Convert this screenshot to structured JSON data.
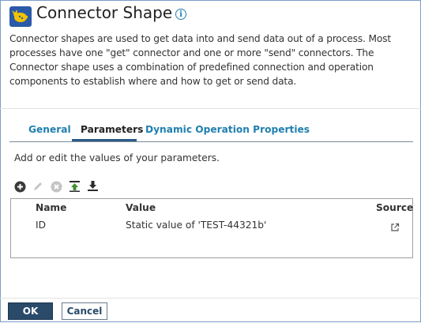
{
  "header": {
    "title": "Connector Shape",
    "icon": "connector-icon",
    "info_icon": "info-icon",
    "info_glyph": "i"
  },
  "description": "Connector shapes are used to get data into and send data out of a process. Most processes have one \"get\" connector and one or more \"send\" connectors. The Connector shape uses a combination of predefined connection and operation components to establish where and how to get or send data.",
  "tabs": [
    {
      "label": "General",
      "active": false
    },
    {
      "label": "Parameters",
      "active": true
    },
    {
      "label": "Dynamic Operation Properties",
      "active": false
    }
  ],
  "parameters": {
    "subtitle": "Add or edit the values of your parameters.",
    "toolbar": [
      "add-icon",
      "edit-icon",
      "remove-icon",
      "move-up-icon",
      "move-down-icon"
    ],
    "columns": [
      "Name",
      "Value",
      "Source"
    ],
    "rows": [
      {
        "name": "ID",
        "value": "Static value of 'TEST-44321b'",
        "source_icon": "external-link-icon"
      }
    ]
  },
  "footer": {
    "ok_label": "OK",
    "cancel_label": "Cancel"
  },
  "colors": {
    "accent": "#1f7fb0",
    "primary_button": "#2a4a6a",
    "icon_bg": "#2a5aa8",
    "icon_fg": "#f2c200"
  }
}
